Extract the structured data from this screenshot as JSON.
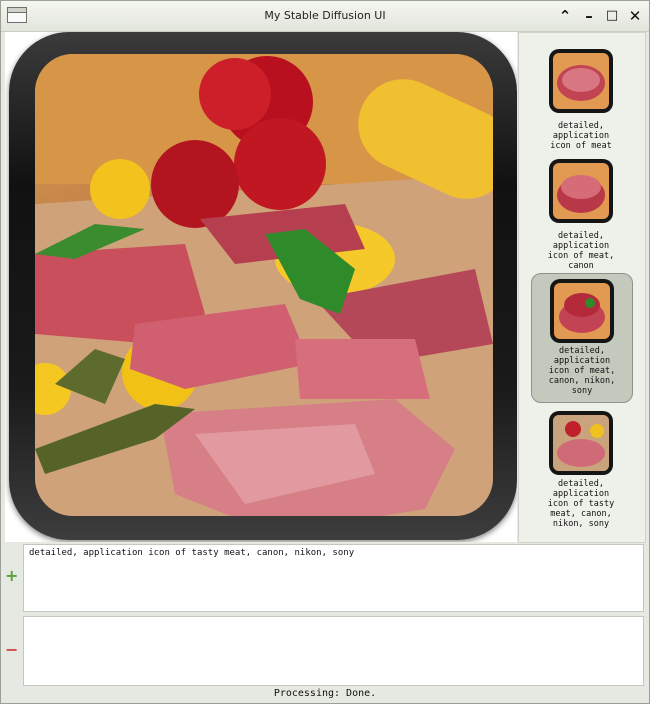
{
  "window": {
    "title": "My Stable Diffusion UI"
  },
  "titlebar_buttons": [
    {
      "name": "chevron-up-icon",
      "glyph": "⌃"
    },
    {
      "name": "minimize-icon",
      "glyph": "–"
    },
    {
      "name": "maximize-icon",
      "glyph": "□"
    },
    {
      "name": "close-icon",
      "glyph": "✕"
    }
  ],
  "gallery": {
    "items": [
      {
        "label": "detailed,\napplication\nicon of meat",
        "selected": false
      },
      {
        "label": "detailed,\napplication\nicon of meat,\ncanon",
        "selected": false
      },
      {
        "label": "detailed,\napplication\nicon of meat,\ncanon, nikon,\nsony",
        "selected": true
      },
      {
        "label": "detailed,\napplication\nicon of tasty\nmeat, canon,\nnikon, sony",
        "selected": false
      }
    ]
  },
  "prompt": {
    "value": "detailed, application icon of tasty meat, canon, nikon, sony"
  },
  "negative_prompt": {
    "value": ""
  },
  "add_button_glyph": "+",
  "remove_button_glyph": "−",
  "status": "Processing: Done."
}
